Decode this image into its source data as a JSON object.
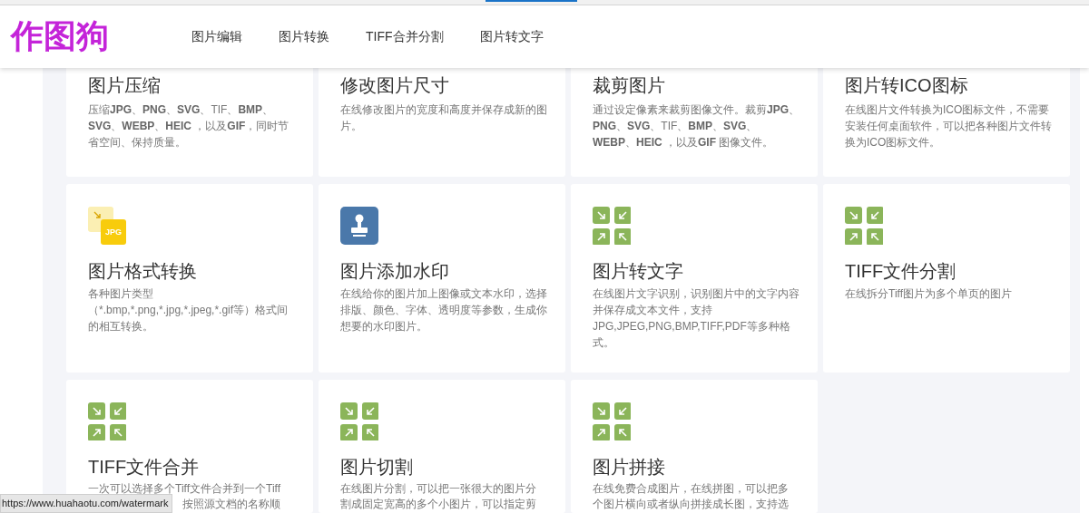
{
  "header": {
    "logo": "作图狗",
    "nav": [
      {
        "label": "图片编辑"
      },
      {
        "label": "图片转换"
      },
      {
        "label": "TIFF合并分割"
      },
      {
        "label": "图片转文字"
      }
    ]
  },
  "cards": [
    {
      "title": "图片压缩",
      "description_rich": "压缩**JPG**、**PNG**、**SVG**、TIF、**BMP**、**SVG**、**WEBP**、**HEIC** ，以及**GIF**，同时节省空间、保持质量。"
    },
    {
      "title": "修改图片尺寸",
      "description": "在线修改图片的宽度和高度并保存成新的图片。"
    },
    {
      "title": "裁剪图片",
      "description_rich": "通过设定像素来裁剪图像文件。裁剪**JPG**、**PNG**、**SVG**、TIF、**BMP**、**SVG**、**WEBP**、**HEIC** ，以及**GIF** 图像文件。"
    },
    {
      "title": "图片转ICO图标",
      "description": "在线图片文件转换为ICO图标文件，不需要安装任何桌面软件，可以把各种图片文件转换为ICO图标文件。"
    },
    {
      "icon": {
        "kind": "jpg",
        "label": "JPG"
      },
      "title": "图片格式转换",
      "description": "各种图片类型（*.bmp,*.png,*.jpg,*.jpeg,*.gif等）格式间的相互转换。"
    },
    {
      "icon": {
        "kind": "stamp"
      },
      "title": "图片添加水印",
      "description": "在线给你的图片加上图像或文本水印，选择排版、颜色、字体、透明度等参数，生成你想要的水印图片。"
    },
    {
      "icon": {
        "kind": "arrows"
      },
      "title": "图片转文字",
      "description": "在线图片文字识别，识别图片中的文字内容并保存成文本文件，支持JPG,JPEG,PNG,BMP,TIFF,PDF等多种格式。"
    },
    {
      "icon": {
        "kind": "arrows"
      },
      "title": "TIFF文件分割",
      "description": "在线拆分Tiff图片为多个单页的图片"
    },
    {
      "icon": {
        "kind": "arrows"
      },
      "title": "TIFF文件合并",
      "description_lines": [
        "一次可以选择多个Tiff文件合并到一个Tiff",
        "按照源文档的名称顺"
      ]
    },
    {
      "icon": {
        "kind": "arrows"
      },
      "title": "图片切割",
      "description_lines": [
        "在线图片分割，可以把一张很大的图片分",
        "割成固定宽高的多个小图片，可以指定剪"
      ]
    },
    {
      "icon": {
        "kind": "arrows"
      },
      "title": "图片拼接",
      "description_lines": [
        "在线免费合成图片，在线拼图，可以把多",
        "个图片横向或者纵向拼接成长图，支持选"
      ]
    }
  ],
  "status_tooltip": "https://www.huahaotu.com/watermark"
}
